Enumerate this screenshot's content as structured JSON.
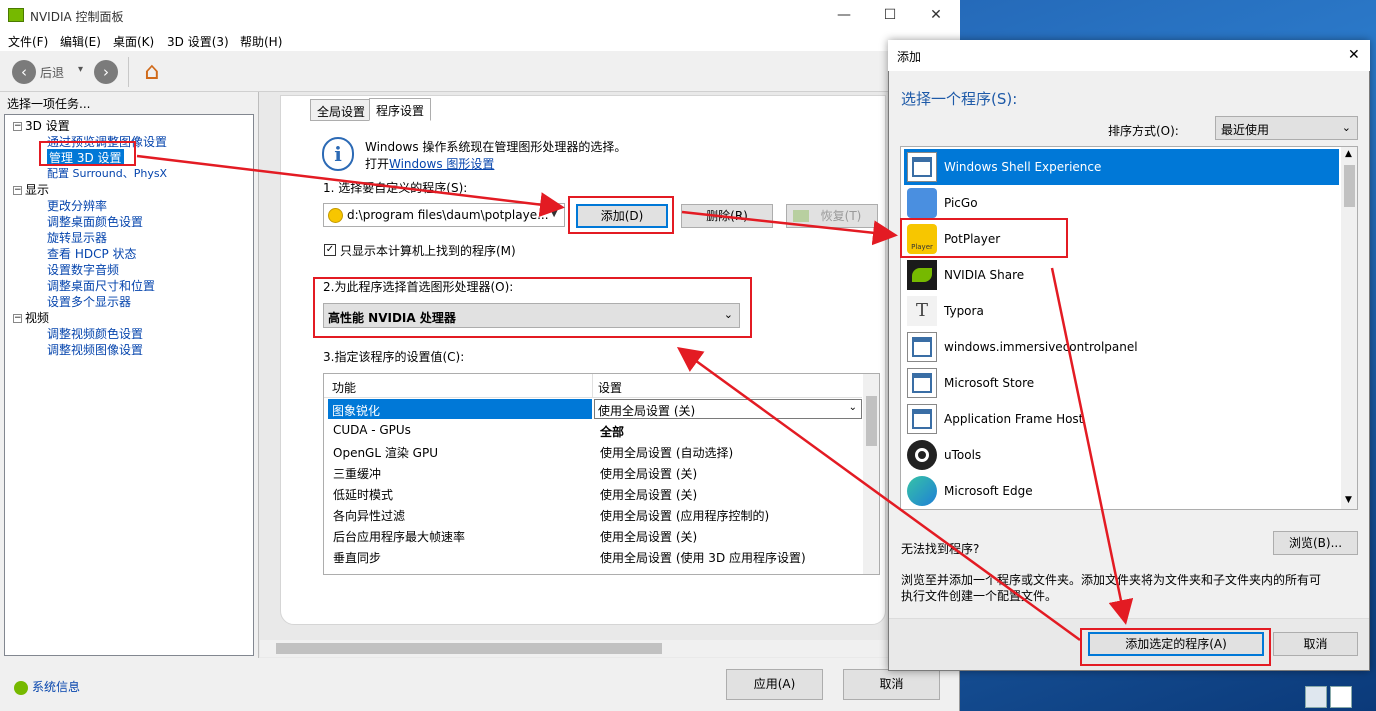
{
  "main_window": {
    "title": "NVIDIA 控制面板",
    "minimize": "—",
    "maximize": "☐",
    "close": "✕",
    "menu": [
      "文件(F)",
      "编辑(E)",
      "桌面(K)",
      "3D 设置(3)",
      "帮助(H)"
    ],
    "toolbar": {
      "back_label": "后退",
      "back_glyph": "‹",
      "forward_glyph": "›",
      "dropdown_glyph": "▾",
      "home_glyph": "⌂"
    },
    "task_header": "选择一项任务...",
    "tree": {
      "cat_3d": "3D 设置",
      "item_adjust_preview": "通过预览调整图像设置",
      "item_manage_3d": "管理 3D 设置",
      "item_surround": "配置 Surround、PhysX",
      "cat_display": "显示",
      "item_resolution": "更改分辨率",
      "item_color": "调整桌面颜色设置",
      "item_rotate": "旋转显示器",
      "item_hdcp": "查看 HDCP 状态",
      "item_audio": "设置数字音频",
      "item_size": "调整桌面尺寸和位置",
      "item_multi": "设置多个显示器",
      "cat_video": "视频",
      "item_video_color": "调整视频颜色设置",
      "item_video_image": "调整视频图像设置",
      "expander": "−"
    },
    "system_info": "系统信息",
    "tabs": {
      "global": "全局设置",
      "program": "程序设置"
    },
    "info_icon": "i",
    "info_line1": "Windows 操作系统现在管理图形处理器的选择。",
    "info_line2_prefix": "打开",
    "info_link": "Windows 图形设置",
    "step1": "1. 选择要自定义的程序(S):",
    "program_combo": "d:\\program files\\daum\\potplaye...",
    "btn_add": "添加(D)",
    "btn_remove": "删除(R)",
    "btn_restore": "恢复(T)",
    "checkbox_label": "只显示本计算机上找到的程序(M)",
    "checkbox_mark": "✓",
    "step2": "2.为此程序选择首选图形处理器(O):",
    "gpu_value": "高性能 NVIDIA 处理器",
    "step3": "3.指定该程序的设置值(C):",
    "table_headers": {
      "feature": "功能",
      "setting": "设置"
    },
    "table_rows": [
      {
        "feature": "图象锐化",
        "setting": "使用全局设置 (关)"
      },
      {
        "feature": "CUDA - GPUs",
        "setting": "全部"
      },
      {
        "feature": "OpenGL 渲染 GPU",
        "setting": "使用全局设置 (自动选择)"
      },
      {
        "feature": "三重缓冲",
        "setting": "使用全局设置 (关)"
      },
      {
        "feature": "低延时模式",
        "setting": "使用全局设置 (关)"
      },
      {
        "feature": "各向异性过滤",
        "setting": "使用全局设置 (应用程序控制的)"
      },
      {
        "feature": "后台应用程序最大帧速率",
        "setting": "使用全局设置 (关)"
      },
      {
        "feature": "垂直同步",
        "setting": "使用全局设置 (使用 3D 应用程序设置)"
      }
    ],
    "btn_apply": "应用(A)",
    "btn_cancel": "取消"
  },
  "add_dialog": {
    "title": "添加",
    "close": "✕",
    "heading": "选择一个程序(S):",
    "sort_label": "排序方式(O):",
    "sort_value": "最近使用",
    "programs": [
      {
        "name": "Windows Shell Experience",
        "icon": "window-icon",
        "selected": true
      },
      {
        "name": "PicGo",
        "icon": "picgo-icon",
        "selected": false
      },
      {
        "name": "PotPlayer",
        "icon": "potplayer-icon",
        "selected": false
      },
      {
        "name": "NVIDIA Share",
        "icon": "nvidia-icon",
        "selected": false
      },
      {
        "name": "Typora",
        "icon": "typora-icon",
        "selected": false
      },
      {
        "name": "windows.immersivecontrolpanel",
        "icon": "window-icon",
        "selected": false
      },
      {
        "name": "Microsoft Store",
        "icon": "window-icon",
        "selected": false
      },
      {
        "name": "Application Frame Host",
        "icon": "window-icon",
        "selected": false
      },
      {
        "name": "uTools",
        "icon": "utools-icon",
        "selected": false
      },
      {
        "name": "Microsoft Edge",
        "icon": "edge-icon",
        "selected": false
      }
    ],
    "potplayer_icon_label": "Player",
    "typora_glyph": "T",
    "not_found": "无法找到程序?",
    "btn_browse": "浏览(B)...",
    "desc_line1": "浏览至并添加一个程序或文件夹。添加文件夹将为文件夹和子文件夹内的所有可",
    "desc_line2": "执行文件创建一个配置文件。",
    "btn_add_selected": "添加选定的程序(A)",
    "btn_cancel": "取消"
  },
  "colors": {
    "accent": "#0078d7",
    "annotation_red": "#e31b23",
    "nvidia_green": "#76b900",
    "link": "#0645ad"
  }
}
